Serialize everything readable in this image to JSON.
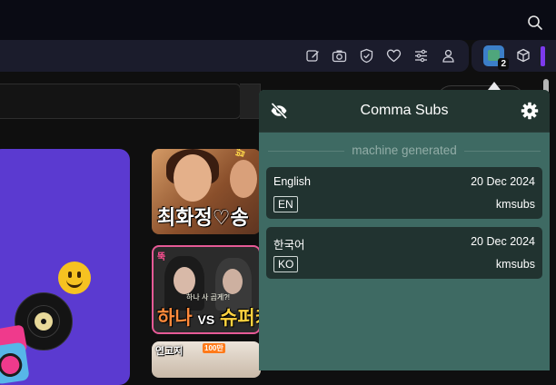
{
  "popup": {
    "title": "Comma Subs",
    "section_label": "machine generated",
    "subtitles": [
      {
        "language": "English",
        "code": "EN",
        "date": "20 Dec 2024",
        "author": "kmsubs"
      },
      {
        "language": "한국어",
        "code": "KO",
        "date": "20 Dec 2024",
        "author": "kmsubs"
      }
    ]
  },
  "extension": {
    "badge_count": "2"
  },
  "thumbnails": [
    {
      "caption_a": "최화정",
      "heart": "♡",
      "caption_b": "송",
      "tag": "밥 |녀에"
    },
    {
      "corner": "뚝",
      "sub": "하나 사 곱게?!",
      "caption_a": "하나",
      "vs": "VS",
      "caption_b": "슈퍼키"
    },
    {
      "label": "연고지",
      "badge": "100만"
    }
  ],
  "colors": {
    "popup_bg": "#3e6a63",
    "popup_header": "#233631",
    "card_bg": "#213330",
    "banner": "#5b3ad0",
    "accent_purple": "#7c3aed"
  },
  "icons": [
    "search-icon",
    "edit-icon",
    "camera-icon",
    "shield-icon",
    "heart-icon",
    "sliders-icon",
    "user-icon",
    "comma-subs-extension-icon",
    "cube-icon",
    "eye-off-icon",
    "gear-icon"
  ]
}
